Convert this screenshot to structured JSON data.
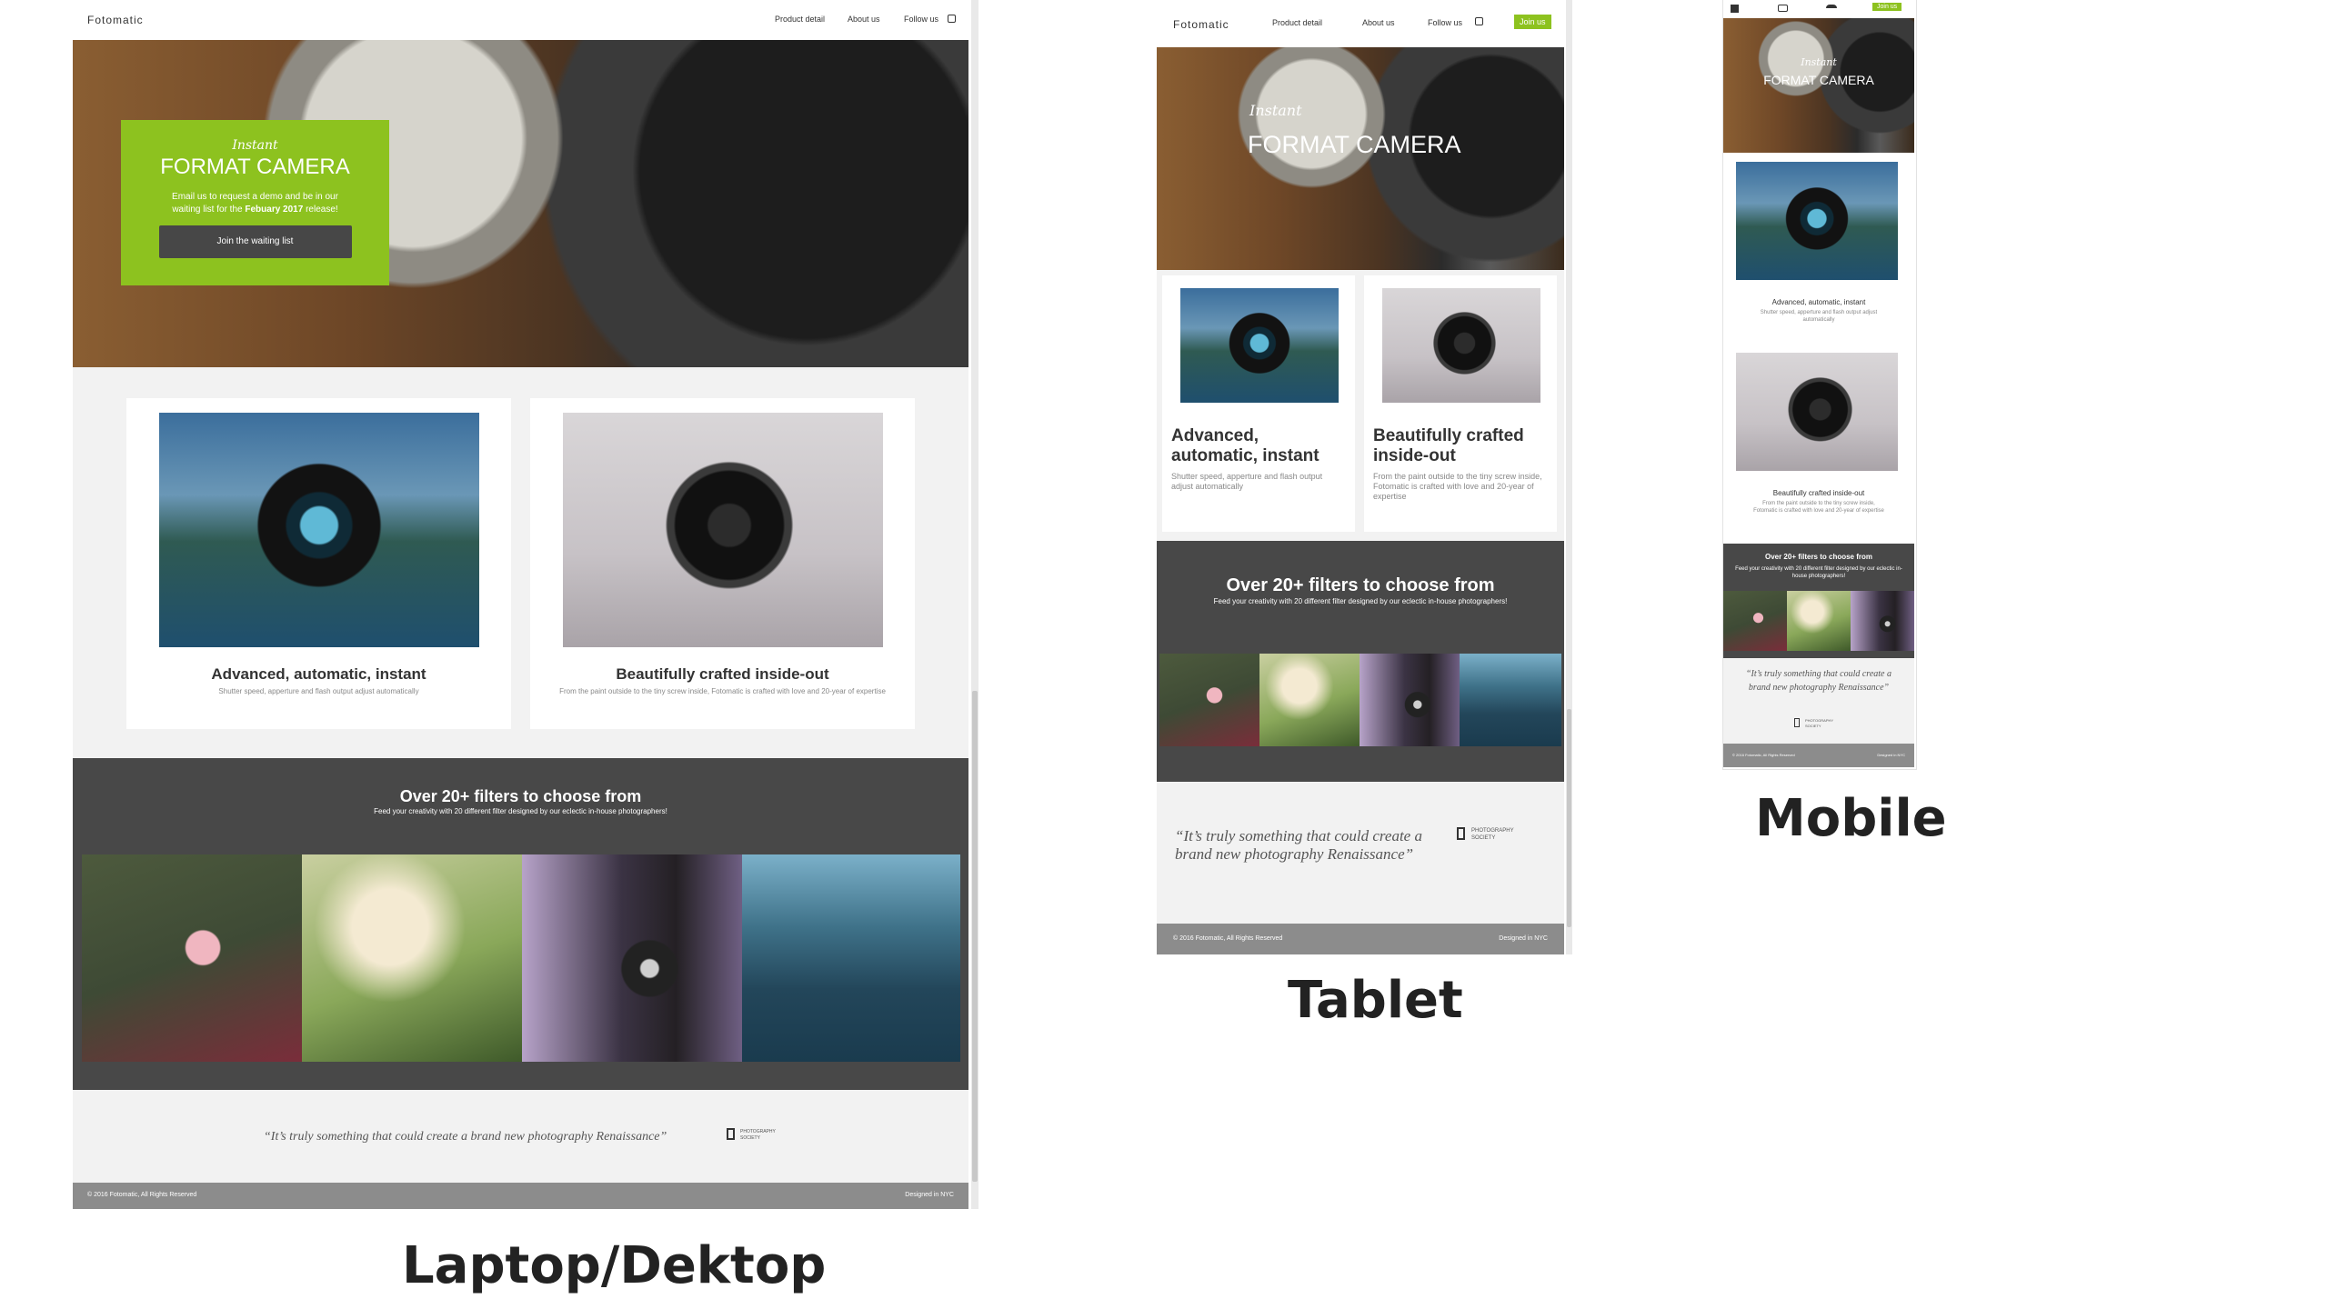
{
  "brand": "Fotomatic",
  "nav": {
    "product": "Product detail",
    "about": "About us",
    "follow": "Follow us",
    "join": "Join us"
  },
  "hero": {
    "kicker": "Instant",
    "title": "FORMAT CAMERA",
    "text_pre": "Email us to request a demo and be in our waiting list for the ",
    "text_bold": "Febuary 2017",
    "text_post": " release!",
    "cta": "Join the waiting list"
  },
  "features": [
    {
      "title": "Advanced, automatic, instant",
      "desc": "Shutter speed, apperture and flash output adjust automatically"
    },
    {
      "title": "Beautifully crafted inside-out",
      "desc": "From the paint outside to the tiny screw inside, Fotomatic is crafted with love and 20-year of expertise"
    }
  ],
  "filters": {
    "title": "Over 20+ filters to choose from",
    "sub": "Feed your creativity with 20 different filter designed by our eclectic in-house photographers!"
  },
  "quote": {
    "text": "“It’s truly something that could create a brand new photography Renaissance”",
    "org": "PHOTOGRAPHY SOCIETY"
  },
  "footer": {
    "copy": "© 2016 Fotomatic, All Rights Reserved",
    "designed": "Designed in NYC"
  },
  "captions": {
    "desktop": "Laptop/Dektop",
    "tablet": "Tablet",
    "mobile": "Mobile"
  },
  "colors": {
    "accent": "#8dc21f",
    "dark": "#484848",
    "footer": "#8c8c8c",
    "light": "#f2f2f2"
  }
}
